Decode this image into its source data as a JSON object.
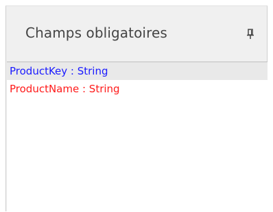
{
  "panel": {
    "title": "Champs obligatoires",
    "pin_icon": "pin-icon",
    "fields": [
      {
        "label": "ProductKey : String",
        "color": "#1a1aff",
        "selected": true
      },
      {
        "label": "ProductName : String",
        "color": "#ff1a1a",
        "selected": false
      }
    ]
  }
}
